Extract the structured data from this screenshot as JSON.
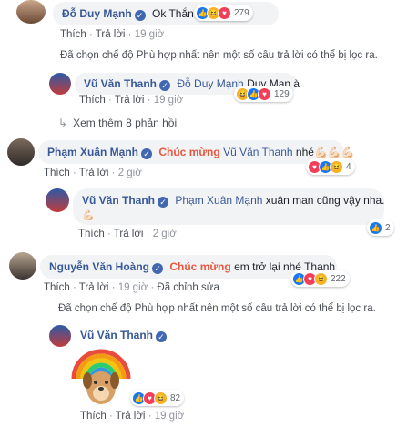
{
  "c1": {
    "name": "Đỗ Duy Mạnh",
    "text": "Ok Thắn",
    "emoji": "💪🏻",
    "count": "279",
    "like": "Thích",
    "reply": "Trả lời",
    "time": "19 giờ"
  },
  "filter_note": "Đã chọn chế độ Phù hợp nhất nên một số câu trả lời có thể bị lọc ra.",
  "r1": {
    "name": "Vũ Văn Thanh",
    "mention": "Đỗ Duy Mạnh",
    "text": "Duy Man à",
    "count": "129",
    "like": "Thích",
    "reply": "Trả lời",
    "time": "19 giờ"
  },
  "more_replies": "Xem thêm 8 phản hồi",
  "c2": {
    "name": "Phạm Xuân Mạnh",
    "highlight": "Chúc mừng",
    "mention": "Vũ Văn Thanh",
    "text": "nhé",
    "emoji": "💪🏻💪🏻💪🏻",
    "count": "4",
    "like": "Thích",
    "reply": "Trả lời",
    "time": "2 giờ"
  },
  "r2": {
    "name": "Vũ Văn Thanh",
    "mention": "Phạm Xuân Mạnh",
    "text": "xuân man cũng vậy nha.",
    "emoji": "💪🏻",
    "count": "2",
    "like": "Thích",
    "reply": "Trả lời",
    "time": "2 giờ"
  },
  "c3": {
    "name": "Nguyễn Văn Hoàng",
    "highlight": "Chúc mừng",
    "text": "em trở lại nhé Thanh",
    "count": "222",
    "like": "Thích",
    "reply": "Trả lời",
    "time": "19 giờ",
    "edited": "Đã chỉnh sửa"
  },
  "filter_note2": "Đã chọn chế độ Phù hợp nhất nên một số câu trả lời có thể bị lọc ra.",
  "r3": {
    "name": "Vũ Văn Thanh",
    "count": "82",
    "like": "Thích",
    "reply": "Trả lời",
    "time": "19 giờ"
  },
  "icons": {
    "verified": "verified-icon",
    "like": "like-reaction-icon",
    "haha": "haha-reaction-icon",
    "love": "love-reaction-icon",
    "arrow": "reply-arrow-icon"
  },
  "colors": {
    "link": "#385898",
    "highlight": "#e9573f",
    "bubble": "#f2f3f5",
    "like": "#1877f2"
  }
}
